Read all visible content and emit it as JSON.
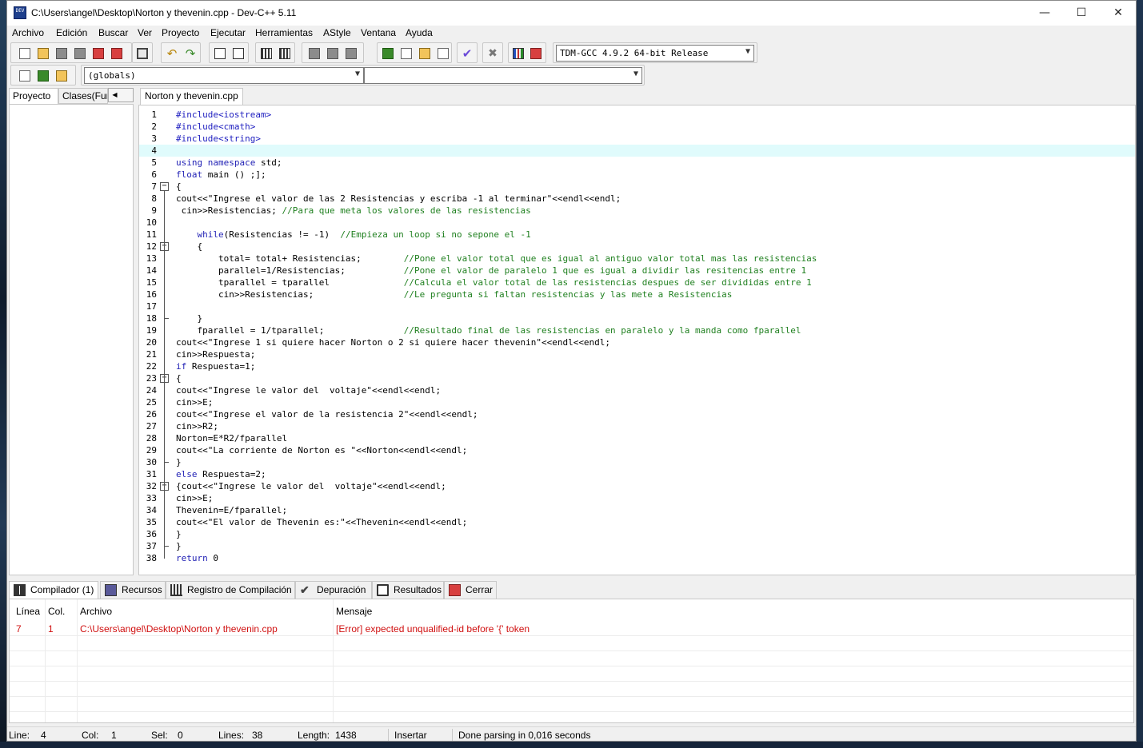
{
  "window": {
    "title": "C:\\Users\\angel\\Desktop\\Norton y thevenin.cpp - Dev-C++ 5.11",
    "app_icon_text": "DEV",
    "minimize_glyph": "—",
    "maximize_glyph": "☐",
    "close_glyph": "✕"
  },
  "menu": [
    "Archivo",
    "Edición",
    "Buscar",
    "Ver",
    "Proyecto",
    "Ejecutar",
    "Herramientas",
    "AStyle",
    "Ventana",
    "Ayuda"
  ],
  "toolbar": {
    "compiler_select": "TDM-GCC 4.9.2 64-bit Release",
    "scope_select": "(globals)",
    "member_select": ""
  },
  "left_panel": {
    "tabs": [
      "Proyecto",
      "Clases(Fun"
    ],
    "scroll_left": "◀",
    "scroll_right": "▶"
  },
  "editor": {
    "tab_label": "Norton y thevenin.cpp",
    "active_line": 4,
    "lines": [
      "#include<iostream>",
      "#include<cmath>",
      "#include<string>",
      "",
      "using namespace std;",
      "float main () ;];",
      "{",
      "cout<<\"Ingrese el valor de las 2 Resistencias y escriba -1 al terminar\"<<endl<<endl;",
      " cin>>Resistencias; //Para que meta los valores de las resistencias",
      "",
      "    while(Resistencias != -1)  //Empieza un loop si no sepone el -1",
      "    {",
      "        total= total+ Resistencias;        //Pone el valor total que es igual al antiguo valor total mas las resistencias",
      "        parallel=1/Resistencias;           //Pone el valor de paralelo 1 que es igual a dividir las resitencias entre 1",
      "        tparallel = tparallel              //Calcula el valor total de las resistencias despues de ser divididas entre 1",
      "        cin>>Resistencias;                 //Le pregunta si faltan resistencias y las mete a Resistencias",
      "",
      "    }",
      "    fparallel = 1/tparallel;               //Resultado final de las resistencias en paralelo y la manda como fparallel",
      "cout<<\"Ingrese 1 si quiere hacer Norton o 2 si quiere hacer thevenin\"<<endl<<endl;",
      "cin>>Respuesta;",
      "if Respuesta=1;",
      "{",
      "cout<<\"Ingrese le valor del  voltaje\"<<endl<<endl;",
      "cin>>E;",
      "cout<<\"Ingrese el valor de la resistencia 2\"<<endl<<endl;",
      "cin>>R2;",
      "Norton=E*R2/fparallel",
      "cout<<\"La corriente de Norton es \"<<Norton<<endl<<endl;",
      "}",
      "else Respuesta=2;",
      "{cout<<\"Ingrese le valor del  voltaje\"<<endl<<endl;",
      "cin>>E;",
      "Thevenin=E/fparallel;",
      "cout<<\"El valor de Thevenin es:\"<<Thevenin<<endl<<endl;",
      "}",
      "}",
      "return 0"
    ]
  },
  "bottom_panel": {
    "tabs": [
      "Compilador (1)",
      "Recursos",
      "Registro de Compilación",
      "Depuración",
      "Resultados",
      "Cerrar"
    ],
    "columns": [
      "Línea",
      "Col.",
      "Archivo",
      "Mensaje"
    ],
    "rows": [
      {
        "line": "7",
        "col": "1",
        "file": "C:\\Users\\angel\\Desktop\\Norton y thevenin.cpp",
        "message": "[Error] expected unqualified-id before '{' token"
      }
    ]
  },
  "status": {
    "line_label": "Line:",
    "line_value": "4",
    "col_label": "Col:",
    "col_value": "1",
    "sel_label": "Sel:",
    "sel_value": "0",
    "lines_label": "Lines:",
    "lines_value": "38",
    "length_label": "Length:",
    "length_value": "1438",
    "mode": "Insertar",
    "message": "Done parsing in 0,016 seconds"
  },
  "colors": {
    "keyword": "#1f1fb4",
    "comment": "#208020",
    "active_line_bg": "#e0fbfc",
    "error_text": "#d01010"
  }
}
